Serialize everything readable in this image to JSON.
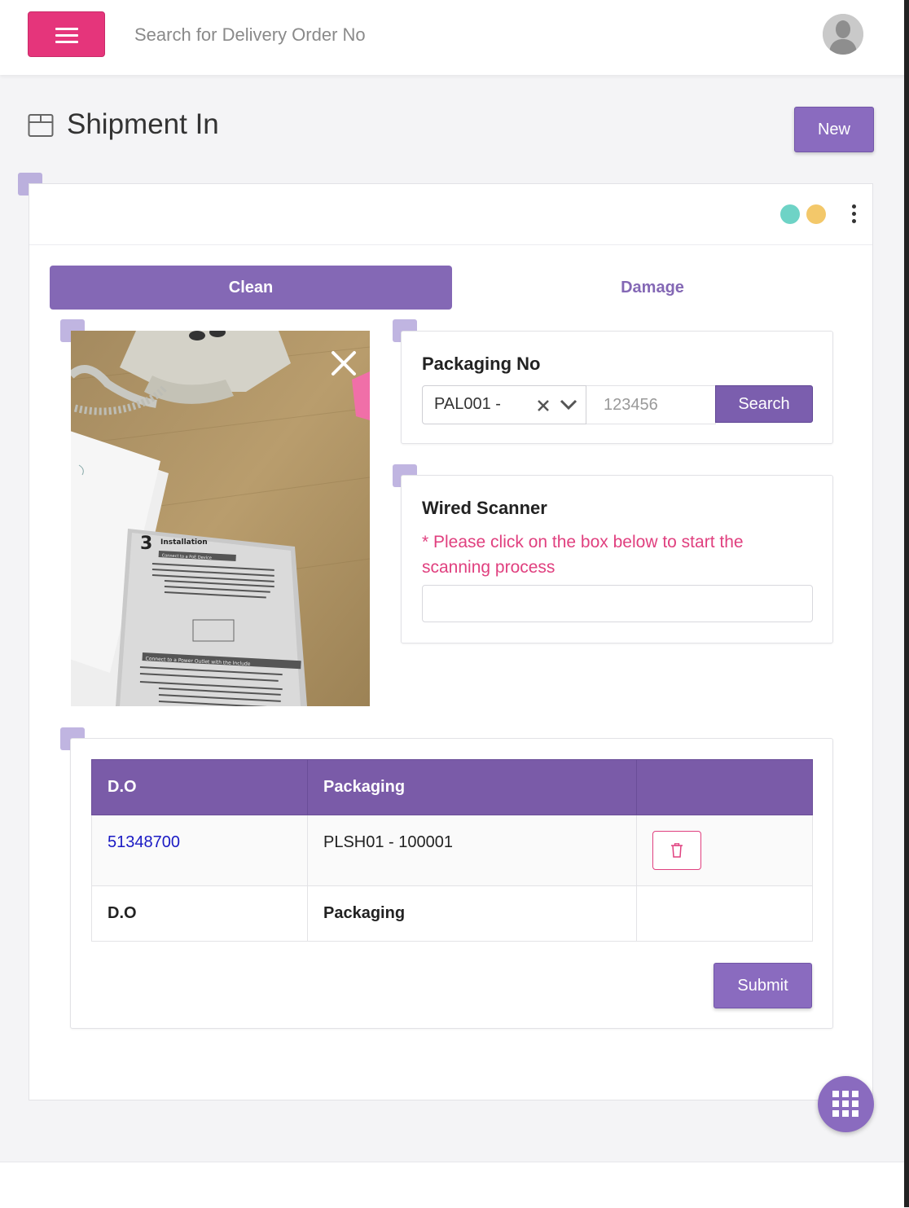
{
  "header": {
    "search_placeholder": "Search for Delivery Order No"
  },
  "page": {
    "title": "Shipment In",
    "new_label": "New"
  },
  "status_dots": [
    "#6ed3c6",
    "#f3c86a"
  ],
  "tabs": [
    {
      "label": "Clean",
      "active": true
    },
    {
      "label": "Damage",
      "active": false
    }
  ],
  "photo": {
    "manual_heading": "Installation",
    "manual_subheading": "Connect to a PoE Device",
    "manual_section2": "Connect to a Power Outlet with the Include"
  },
  "packaging": {
    "title": "Packaging No",
    "select_value": "PAL001 -",
    "input_placeholder": "123456",
    "search_label": "Search"
  },
  "scanner": {
    "title": "Wired Scanner",
    "hint": "* Please click on the box below to start the scanning process"
  },
  "table": {
    "headers": [
      "D.O",
      "Packaging",
      ""
    ],
    "rows": [
      {
        "do": "51348700",
        "packaging": "PLSH01 - 100001"
      }
    ],
    "footer": [
      "D.O",
      "Packaging",
      ""
    ]
  },
  "submit_label": "Submit"
}
